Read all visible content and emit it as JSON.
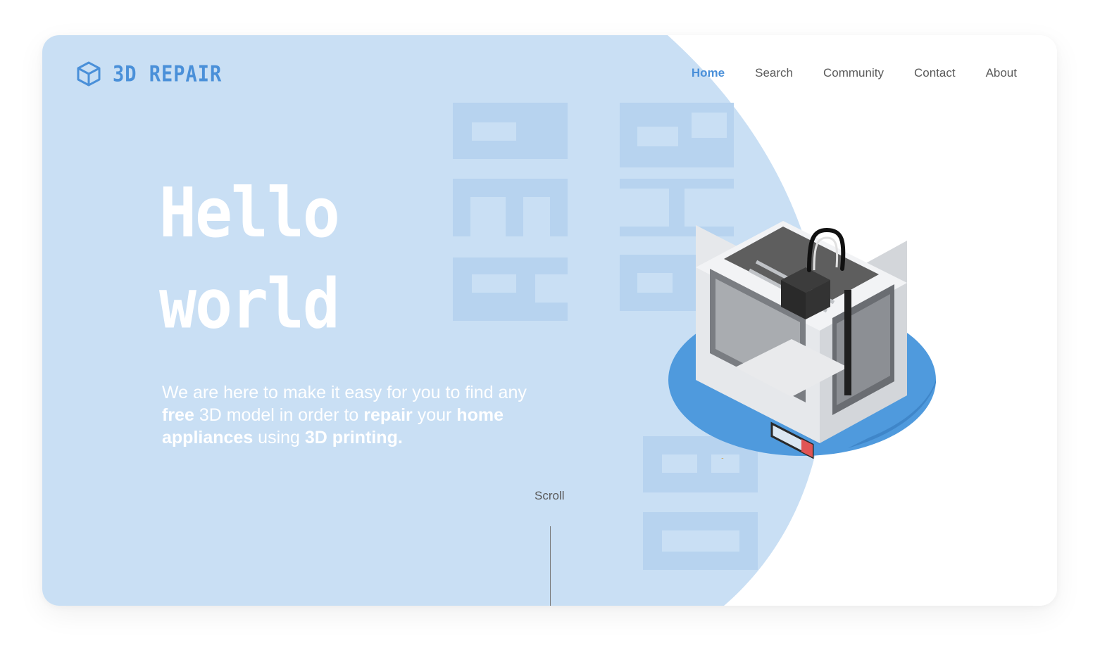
{
  "brand": {
    "name": "3D REPAIR",
    "icon": "cube-icon"
  },
  "nav": {
    "items": [
      {
        "label": "Home",
        "active": true
      },
      {
        "label": "Search",
        "active": false
      },
      {
        "label": "Community",
        "active": false
      },
      {
        "label": "Contact",
        "active": false
      },
      {
        "label": "About",
        "active": false
      }
    ]
  },
  "hero": {
    "title_line1": "Hello",
    "title_line2": "world",
    "tagline": [
      {
        "text": "We are here to make it easy for you to find any ",
        "bold": false
      },
      {
        "text": "free",
        "bold": true
      },
      {
        "text": " 3D model in order to ",
        "bold": false
      },
      {
        "text": "repair",
        "bold": true
      },
      {
        "text": " your ",
        "bold": false
      },
      {
        "text": "home appliances",
        "bold": true
      },
      {
        "text": " using ",
        "bold": false
      },
      {
        "text": "3D printing.",
        "bold": true
      }
    ]
  },
  "scroll": {
    "label": "Scroll"
  },
  "watermark": {
    "text": "3D REPAIR"
  },
  "colors": {
    "accent": "#4a90d9",
    "hero_bg": "#c9dff4",
    "watermark": "#b7d3ef",
    "nav_text": "#5a5a5a",
    "printer_base": "#4f9add"
  }
}
